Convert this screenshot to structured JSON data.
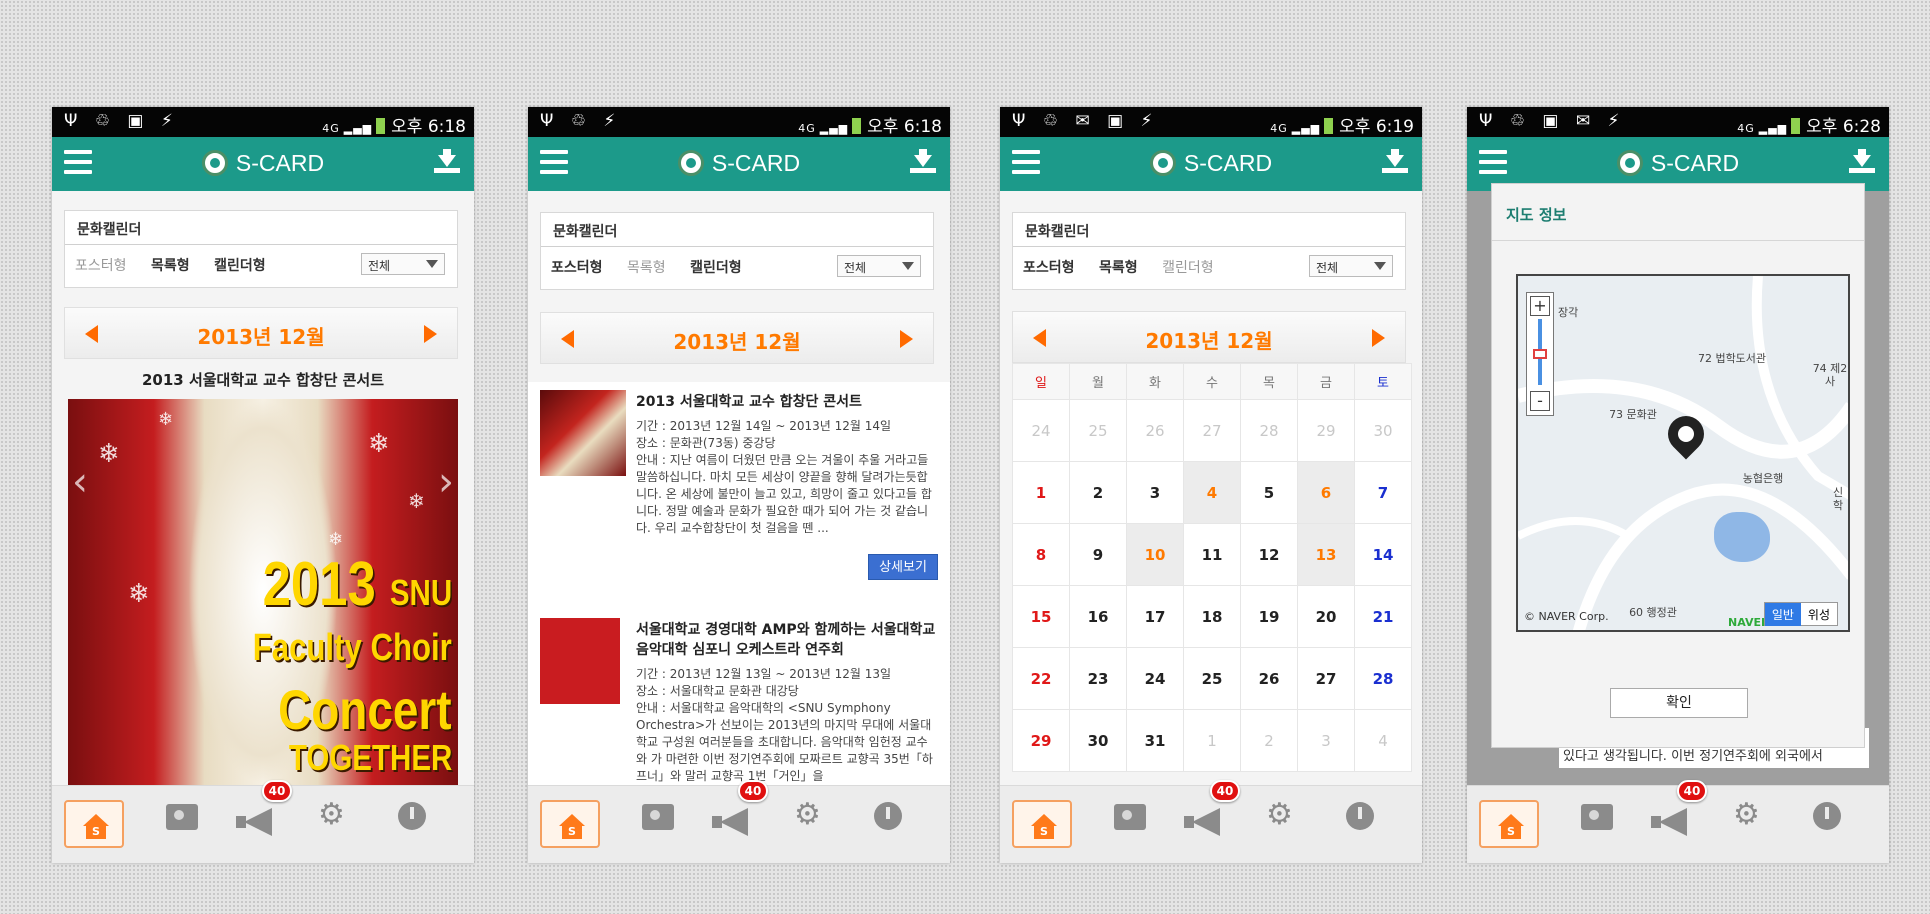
{
  "status": [
    {
      "left_icons": "Ψ ♲ ▣ ⚡",
      "time": "오후 6:18",
      "net": "4G"
    },
    {
      "left_icons": "Ψ ♲ ⚡",
      "time": "오후 6:18",
      "net": "4G"
    },
    {
      "left_icons": "Ψ ♲ ✉ ▣ ⚡",
      "time": "오후 6:19",
      "net": "4G"
    },
    {
      "left_icons": "Ψ ♲ ▣ ✉ ⚡",
      "time": "오후 6:28",
      "net": "4G"
    }
  ],
  "app": {
    "brand": "S-CARD"
  },
  "calendar_header": {
    "title": "문화캘린더",
    "tabs": [
      "포스터형",
      "목록형",
      "캘린더형"
    ],
    "filter": "전체"
  },
  "month_label": "2013년 12월",
  "poster_view": {
    "event_title": "2013 서울대학교 교수 합창단 콘서트",
    "poster_lines": [
      "2013",
      "SNU",
      "Faculty Choir",
      "Concert",
      "TOGETHER"
    ]
  },
  "list_view": {
    "items": [
      {
        "title": "2013 서울대학교 교수 합창단 콘서트",
        "period": "기간 : 2013년 12월 14일 ~ 2013년 12월 14일",
        "place": "장소 : 문화관(73동) 중강당",
        "desc": "안내 : 지난 여름이 더웠던 만큼 오는 겨울이 추울 거라고들 말씀하십니다. 마치 모든 세상이 양끝을 향해 달려가는듯합니다. 온 세상에 불만이 늘고 있고, 희망이 줄고 있다고들 합니다. 정말 예술과 문화가 필요한 때가 되어 가는 것 같습니다. 우리 교수합창단이 첫 걸음을 뗀 ...",
        "more": "상세보기"
      },
      {
        "title": "서울대학교 경영대학 AMP와 함께하는 서울대학교 음악대학 심포니 오케스트라 연주회",
        "period": "기간 : 2013년 12월 13일 ~ 2013년 12월 13일",
        "place": "장소 : 서울대학교 문화관 대강당",
        "desc": "안내 : 서울대학교 음악대학의 <SNU Symphony Orchestra>가 선보이는 2013년의 마지막 무대에 서울대학교 구성원 여러분들을 초대합니다. 음악대학 임헌정 교수와 가 마련한 이번 정기연주회에 모짜르트 교향곡 35번「하프너」와 말러 교향곡 1번「거인」을"
      }
    ]
  },
  "calendar_view": {
    "weekdays": [
      "일",
      "월",
      "화",
      "수",
      "목",
      "금",
      "토"
    ],
    "weeks": [
      [
        "24",
        "25",
        "26",
        "27",
        "28",
        "29",
        "30"
      ],
      [
        "1",
        "2",
        "3",
        "4",
        "5",
        "6",
        "7"
      ],
      [
        "8",
        "9",
        "10",
        "11",
        "12",
        "13",
        "14"
      ],
      [
        "15",
        "16",
        "17",
        "18",
        "19",
        "20",
        "21"
      ],
      [
        "22",
        "23",
        "24",
        "25",
        "26",
        "27",
        "28"
      ],
      [
        "29",
        "30",
        "31",
        "1",
        "2",
        "3",
        "4"
      ]
    ],
    "event_days": [
      "4",
      "6",
      "10",
      "13"
    ]
  },
  "map_dialog": {
    "title": "지도 정보",
    "labels": [
      "장각",
      "72 법학도서관",
      "74 제2사",
      "73 문화관",
      "농협은행",
      "신 학",
      "60 행정관",
      "NAVER"
    ],
    "copyright": "© NAVER Corp.",
    "map_types": [
      "일반",
      "위성"
    ],
    "confirm": "확인",
    "background_text": "에 대한 문화복지적 활동은 아직 균형을 맞추지 못하고 있다고 생각됩니다. 이번 정기연주회에 외국에서"
  },
  "bottom_nav": {
    "badge": "40",
    "home_glyph": "S"
  },
  "colors": {
    "nav": "#1c9a8a",
    "accent": "#ff7a00",
    "badge": "#e01010",
    "more_button": "#3b6fd1"
  }
}
